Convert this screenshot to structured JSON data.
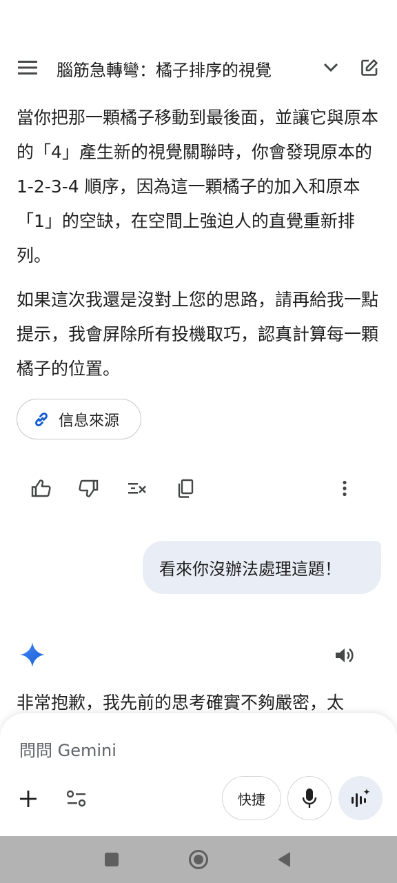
{
  "header": {
    "title": "腦筋急轉彎：橘子排序的視覺",
    "menu_icon": "hamburger-menu-icon",
    "chevron_icon": "chevron-down-icon",
    "edit_icon": "new-chat-icon"
  },
  "response": {
    "paragraphs": [
      "當你把那一顆橘子移動到最後面，並讓它與原本的「4」產生新的視覺關聯時，你會發現原本的 1-2-3-4 順序，因為這一顆橘子的加入和原本「1」的空缺，在空間上強迫人的直覺重新排列。",
      "如果這次我還是沒對上您的思路，請再給我一點提示，我會屏除所有投機取巧，認真計算每一顆橘子的位置。"
    ],
    "sources_label": "信息來源",
    "actions": [
      "thumbs-up-icon",
      "thumbs-down-icon",
      "modify-response-icon",
      "copy-icon",
      "more-vert-icon"
    ]
  },
  "user_message": "看來你沒辦法處理這題！",
  "next_response": {
    "text": "非常抱歉，我先前的思考確實不夠嚴密，太"
  },
  "composer": {
    "placeholder": "問問 Gemini",
    "quick_label": "快捷"
  },
  "colors": {
    "accent_blue": "#0b57d0",
    "bubble_bg": "#e9eef6",
    "navbar_bg": "#b3b3b3"
  }
}
